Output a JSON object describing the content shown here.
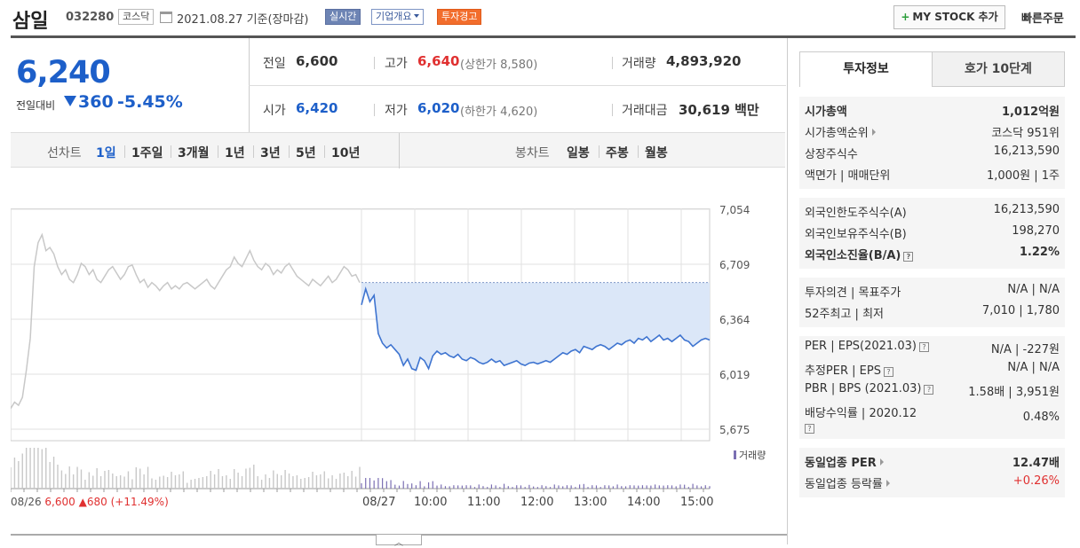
{
  "header": {
    "name": "삼일",
    "code": "032280",
    "market_badge": "코스닥",
    "date_text": "2021.08.27  기준(장마감)",
    "realtime": "실시간",
    "corp_info": "기업개요",
    "warning": "투자경고",
    "mystock": "MY STOCK 추가",
    "quick_order": "빠른주문"
  },
  "price": {
    "current": "6,240",
    "change_label": "전일대비",
    "change": "360",
    "percent": "-5.45%"
  },
  "quote": {
    "prev_label": "전일",
    "prev": "6,600",
    "high_label": "고가",
    "high": "6,640",
    "upper_limit": "(상한가 8,580)",
    "volume_label": "거래량",
    "volume": "4,893,920",
    "open_label": "시가",
    "open": "6,420",
    "low_label": "저가",
    "low": "6,020",
    "lower_limit": "(하한가 4,620)",
    "amount_label": "거래대금",
    "amount": "30,619 백만"
  },
  "periods": {
    "line_label": "선차트",
    "items": [
      "1일",
      "1주일",
      "3개월",
      "1년",
      "3년",
      "5년",
      "10년"
    ],
    "candle_label": "봉차트",
    "candles": [
      "일봉",
      "주봉",
      "월봉"
    ]
  },
  "chart_data": {
    "type": "line",
    "y_ticks": [
      "7,054",
      "6,709",
      "6,364",
      "6,019",
      "5,675"
    ],
    "x_ticks": [
      "08/26",
      "08/27",
      "10:00",
      "11:00",
      "12:00",
      "13:00",
      "14:00",
      "15:00"
    ],
    "volume_label": "거래량",
    "prev_summary_date": "08/26",
    "prev_summary_price": "6,600",
    "prev_summary_change": "680",
    "prev_summary_pct": "(+11.49%)",
    "reference_price": 6600,
    "ylim": [
      5675,
      7054
    ],
    "day1_series": [
      5810,
      5850,
      5830,
      5880,
      6050,
      6250,
      6700,
      6850,
      6900,
      6800,
      6820,
      6780,
      6700,
      6650,
      6680,
      6620,
      6600,
      6650,
      6720,
      6700,
      6650,
      6680,
      6620,
      6600,
      6640,
      6680,
      6700,
      6660,
      6620,
      6650,
      6700,
      6710,
      6650,
      6600,
      6620,
      6570,
      6600,
      6580,
      6550,
      6580,
      6600,
      6560,
      6580,
      6560,
      6590,
      6600,
      6580,
      6560,
      6580,
      6600,
      6620,
      6580,
      6560,
      6600,
      6640,
      6680,
      6700,
      6760,
      6720,
      6700,
      6750,
      6800,
      6740,
      6700,
      6680,
      6720,
      6700,
      6650,
      6680,
      6660,
      6700,
      6720,
      6680,
      6640,
      6620,
      6600,
      6580,
      6620,
      6600,
      6580,
      6610,
      6640,
      6600,
      6620,
      6660,
      6700,
      6680,
      6640,
      6650,
      6600
    ],
    "day2_series": [
      6460,
      6560,
      6480,
      6520,
      6280,
      6220,
      6190,
      6210,
      6180,
      6150,
      6080,
      6120,
      6060,
      6050,
      6130,
      6110,
      6060,
      6140,
      6170,
      6150,
      6160,
      6140,
      6130,
      6150,
      6120,
      6110,
      6130,
      6120,
      6100,
      6090,
      6100,
      6120,
      6100,
      6110,
      6080,
      6090,
      6100,
      6110,
      6090,
      6080,
      6095,
      6100,
      6090,
      6100,
      6110,
      6100,
      6120,
      6140,
      6160,
      6150,
      6170,
      6180,
      6160,
      6200,
      6190,
      6180,
      6200,
      6210,
      6200,
      6180,
      6200,
      6220,
      6210,
      6230,
      6240,
      6220,
      6250,
      6240,
      6260,
      6230,
      6250,
      6270,
      6240,
      6250,
      6230,
      6250,
      6270,
      6240,
      6230,
      6200,
      6220,
      6240,
      6250,
      6240
    ]
  },
  "info": {
    "tab_invest": "투자정보",
    "tab_hoga": "호가 10단계",
    "market_cap_k": "시가총액",
    "market_cap_v": "1,012억원",
    "rank_k": "시가총액순위",
    "rank_v": "코스닥 951위",
    "shares_k": "상장주식수",
    "shares_v": "16,213,590",
    "par_k": "액면가 | 매매단위",
    "par_v": "1,000원 | 1주",
    "foreign_limit_k": "외국인한도주식수(A)",
    "foreign_limit_v": "16,213,590",
    "foreign_hold_k": "외국인보유주식수(B)",
    "foreign_hold_v": "198,270",
    "foreign_ratio_k": "외국인소진율(B/A)",
    "foreign_ratio_v": "1.22%",
    "opinion_k": "투자의견 | 목표주가",
    "opinion_v": "N/A | N/A",
    "w52_k": "52주최고 | 최저",
    "w52_v": "7,010 | 1,780",
    "per_k": "PER | EPS(2021.03)",
    "per_v": "N/A | -227원",
    "est_per_k": "추정PER | EPS",
    "est_per_v": "N/A | N/A",
    "pbr_k": "PBR | BPS (2021.03)",
    "pbr_v": "1.58배 | 3,951원",
    "div_k": "배당수익률 | 2020.12",
    "div_v": "0.48%",
    "sector_per_k": "동일업종 PER",
    "sector_per_v": "12.47배",
    "sector_rate_k": "동일업종 등락률",
    "sector_rate_v": "+0.26%"
  }
}
